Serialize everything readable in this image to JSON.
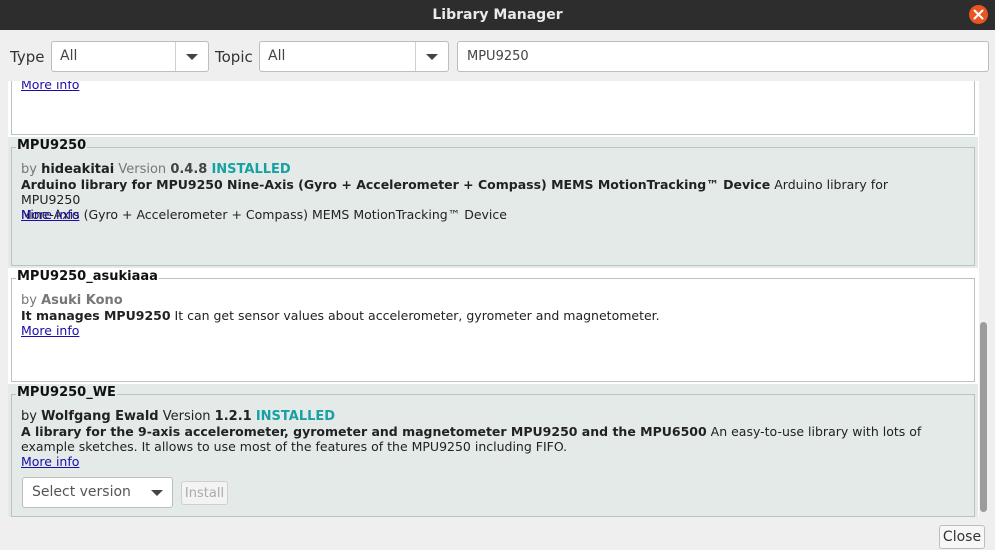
{
  "window": {
    "title": "Library Manager"
  },
  "filters": {
    "type_label": "Type",
    "type_value": "All",
    "topic_label": "Topic",
    "topic_value": "All",
    "search_value": "MPU9250"
  },
  "list": {
    "partial_more_info": "More info",
    "entries": [
      {
        "name": "MPU9250",
        "by": "by ",
        "author": "hideakitai",
        "version_label": " Version ",
        "version": "0.4.8",
        "status": "INSTALLED",
        "title": "Arduino library for MPU9250 Nine-Axis (Gyro + Accelerometer + Compass) MEMS MotionTracking™ Device",
        "description_1": " Arduino library for MPU9250",
        "description_2": "Nine-Axis (Gyro + Accelerometer + Compass) MEMS MotionTracking™ Device",
        "more_info": "More info"
      },
      {
        "name": "MPU9250_asukiaaa",
        "by": "by ",
        "author": "Asuki Kono",
        "title": "It manages MPU9250",
        "description_1": " It can get sensor values about accelerometer, gyrometer and magnetometer.",
        "more_info": "More info"
      },
      {
        "name": "MPU9250_WE",
        "by": "by ",
        "author": "Wolfgang Ewald",
        "version_label": "  Version ",
        "version": "1.2.1",
        "status": "INSTALLED",
        "title": "A library for the 9-axis accelerometer, gyrometer and magnetometer MPU9250 and the MPU6500",
        "description_1": " An easy-to-use library with lots of",
        "description_2": "example sketches. It allows to use most of the features of the MPU9250 including FIFO.",
        "more_info": "More info",
        "version_select": "Select version",
        "install_label": "Install"
      }
    ]
  },
  "footer": {
    "close_label": "Close"
  },
  "colors": {
    "installed": "#17a1a5",
    "titlebar": "#2d2d2d",
    "close_icon": "#e95420",
    "selected_entry_bg": "#e3eae8"
  }
}
